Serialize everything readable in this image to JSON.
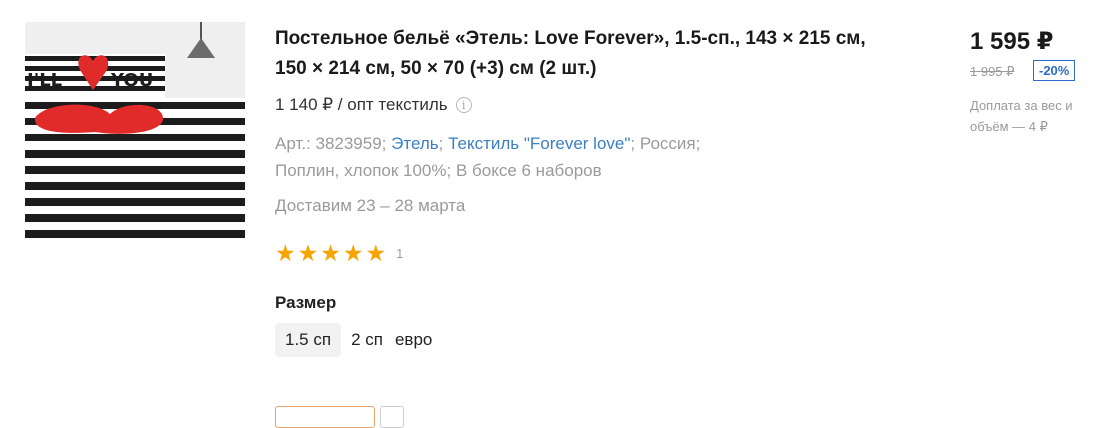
{
  "product": {
    "title": "Постельное бельё «Этель: Love Forever», 1.5-сп., 143 × 215 см, 150 × 214 см, 50 × 70 (+3) см (2 шт.)",
    "image_text_left": "I'LL",
    "image_text_right": "YOU",
    "wholesale_price": "1 140 ₽ / опт текстиль",
    "info_icon_glyph": "i",
    "specs": {
      "prefix": "Арт.: 3823959; ",
      "brand_link": "Этель",
      "sep1": "; ",
      "collection_link": "Текстиль \"Forever love\"",
      "rest_line1": "; Россия;",
      "line2": "Поплин, хлопок 100%; В боксе 6 наборов"
    },
    "delivery": "Доставим 23 – 28 марта",
    "rating": {
      "stars": 5,
      "count": "1",
      "star_color": "#f6a400"
    },
    "size": {
      "label": "Размер",
      "options": [
        "1.5 сп",
        "2 сп",
        "евро"
      ],
      "selected": "1.5 сп"
    }
  },
  "pricing": {
    "price": "1 595 ₽",
    "old_price": "1 995 ₽",
    "discount": "-20%",
    "discount_color": "#2e6bc8",
    "surcharge": "Доплата за вес и объём — 4 ₽"
  }
}
